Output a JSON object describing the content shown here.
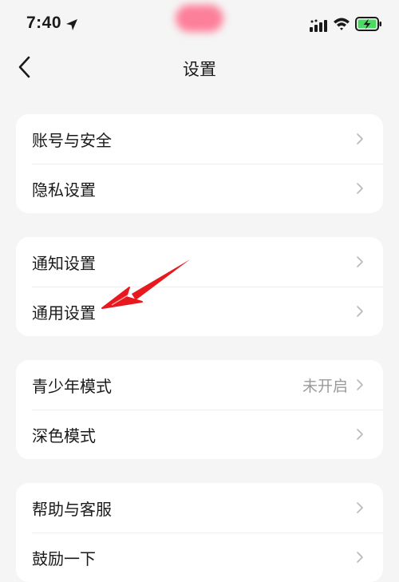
{
  "status_bar": {
    "time": "7:40",
    "icons": [
      "location-arrow-icon",
      "cellular-signal-icon",
      "wifi-icon",
      "battery-charging-icon"
    ],
    "battery_color": "#4cd964"
  },
  "nav": {
    "back_icon": "chevron-left-icon",
    "title": "设置"
  },
  "groups": [
    {
      "items": [
        {
          "label": "账号与安全",
          "value": ""
        },
        {
          "label": "隐私设置",
          "value": ""
        }
      ]
    },
    {
      "items": [
        {
          "label": "通知设置",
          "value": ""
        },
        {
          "label": "通用设置",
          "value": ""
        }
      ]
    },
    {
      "items": [
        {
          "label": "青少年模式",
          "value": "未开启"
        },
        {
          "label": "深色模式",
          "value": ""
        }
      ]
    },
    {
      "items": [
        {
          "label": "帮助与客服",
          "value": ""
        },
        {
          "label": "鼓励一下",
          "value": ""
        }
      ]
    }
  ],
  "annotation": {
    "type": "red-arrow",
    "color": "#e8191e",
    "points_to": "通用设置"
  }
}
